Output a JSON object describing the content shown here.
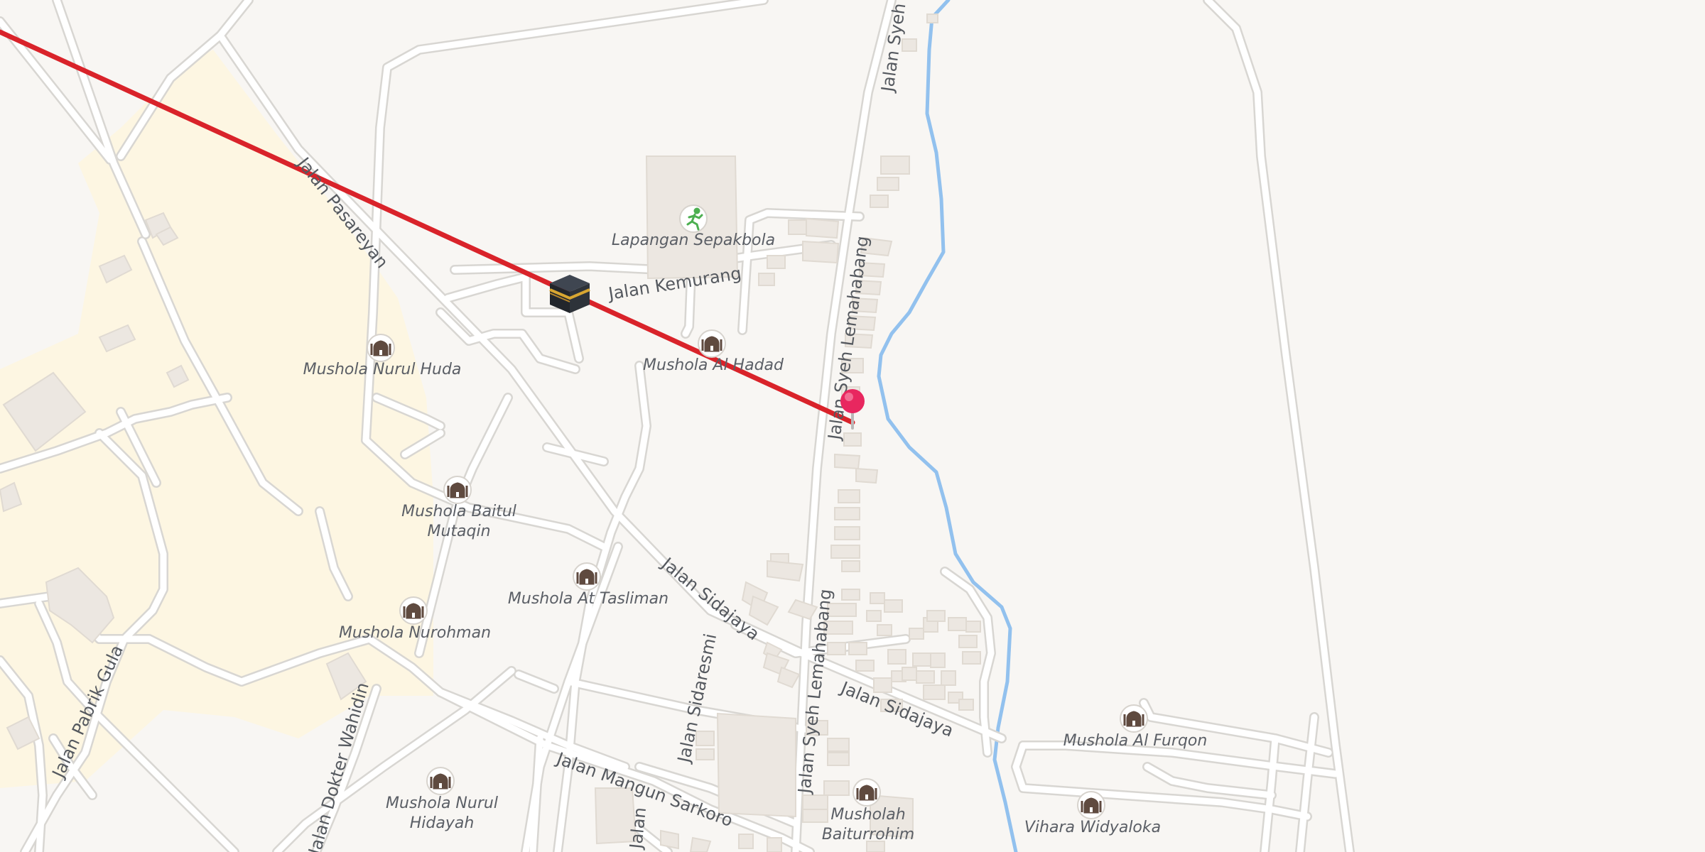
{
  "map": {
    "colors": {
      "background": "#f8f6f3",
      "residential_area": "#fdf6e2",
      "road": "#ffffff",
      "road_casing": "#d8d6d2",
      "building": "#ece7e1",
      "river": "#92c1ee",
      "qibla_line": "#d9232a",
      "pin": "#e8275f",
      "poi_icon_bg": "#ffffff",
      "poi_icon_fg": "#5f4a3f",
      "park_icon": "#4caf50"
    },
    "streets": {
      "pasareyan": "Jalan Pasareyan",
      "kemurang": "Jalan Kemurang",
      "syeh_lemahabang_north": "Jalan Syeh",
      "syeh_lemahabang_mid": "Jalan Syeh Lemahabang",
      "syeh_lemahabang_south": "Jalan Syeh Lemahabang",
      "sidajaya_1": "Jalan Sidajaya",
      "sidajaya_2": "Jalan Sidajaya",
      "sidaresmi": "Jalan Sidaresmi",
      "mangun_sarkoro": "Jalan Mangun Sarkoro",
      "pabrik_gula": "Jalan Pabrik Gula",
      "dokter_wahidin": "Jalan Dokter Wahidin",
      "jalan_partial": "Jalan"
    },
    "pois": {
      "lapangan": "Lapangan Sepakbola",
      "nurul_huda": "Mushola Nurul Huda",
      "al_hadad": "Mushola Al Hadad",
      "baitul_1": "Mushola Baitul",
      "baitul_2": "Mutaqin",
      "at_tasliman": "Mushola At Tasliman",
      "nurohman": "Mushola Nurohman",
      "nurul_hidayah_1": "Mushola Nurul",
      "nurul_hidayah_2": "Hidayah",
      "baiturrohim_1": "Musholah",
      "baiturrohim_2": "Baiturrohim",
      "al_furqon": "Mushola Al Furqon",
      "vihara": "Vihara Widyaloka"
    },
    "icons": {
      "mosque": "mosque-icon",
      "sports": "running-person-icon",
      "kaaba": "kaaba-icon",
      "pin": "location-pin-icon"
    }
  }
}
